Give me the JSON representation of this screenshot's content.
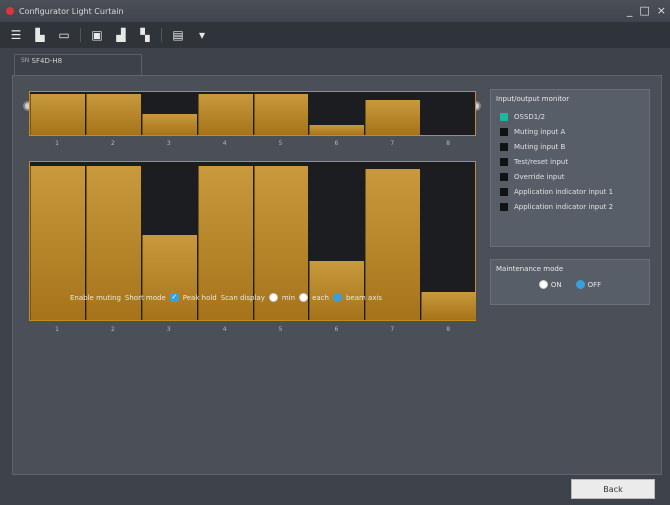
{
  "window": {
    "title": "Configurator Light Curtain",
    "controls": [
      "_",
      "□",
      "×"
    ]
  },
  "toolbar": {
    "icons": [
      "menu-icon",
      "document-icon",
      "folder-icon",
      "save-icon",
      "chart-icon",
      "connect-icon",
      "export-icon",
      "dropdown-icon"
    ]
  },
  "device_tab": {
    "prefix": "SN",
    "label": "SF4D-H8"
  },
  "beams": {
    "numbers": [
      "1",
      "2",
      "3",
      "4",
      "5",
      "6",
      "7",
      "8"
    ],
    "strip_levels": [
      1.0,
      1.0,
      0.5,
      1.0,
      1.0,
      0.25,
      0.85,
      0.0
    ],
    "big_levels": [
      1.0,
      1.0,
      0.55,
      1.0,
      1.0,
      0.38,
      0.98,
      0.18
    ]
  },
  "options": {
    "enable_muting": "Enable muting",
    "short_mode": "Short mode",
    "peak_hold": "Peak hold",
    "peak_hold_checked": true,
    "scan_display": "Scan display",
    "radio_min": "min",
    "radio_each": "each",
    "radio_beam_axis": "beam axis",
    "selected_radio": "beam axis"
  },
  "io_monitor": {
    "title": "Input/output monitor",
    "items": [
      {
        "label": "OSSD1/2",
        "state": "green"
      },
      {
        "label": "Muting input A",
        "state": "off"
      },
      {
        "label": "Muting input B",
        "state": "off"
      },
      {
        "label": "Test/reset input",
        "state": "off"
      },
      {
        "label": "Override input",
        "state": "off"
      },
      {
        "label": "Application indicator input 1",
        "state": "off"
      },
      {
        "label": "Application indicator input 2",
        "state": "off"
      }
    ]
  },
  "maintenance": {
    "title": "Maintenance mode",
    "on_label": "ON",
    "off_label": "OFF",
    "selected": "OFF"
  },
  "back_button": "Back",
  "colors": {
    "beam_gold": "#c18d20",
    "indicator_green": "#1fb79b",
    "accent_blue": "#3aa0d8"
  }
}
